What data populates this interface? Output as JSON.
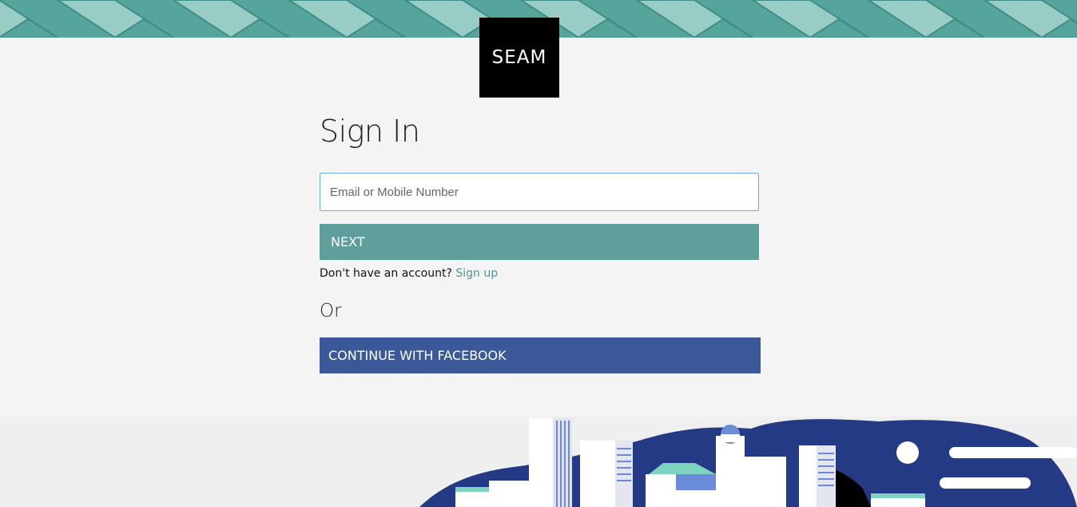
{
  "brand": {
    "logo_text": "SEAM"
  },
  "signin": {
    "title": "Sign In",
    "email_placeholder": "Email or Mobile Number",
    "next_label": "NEXT",
    "no_account_text": "Don't have an account?",
    "signup_link": "Sign up",
    "or_text": "Or",
    "facebook_label": "CONTINUE WITH FACEBOOK"
  },
  "colors": {
    "banner_teal": "#55a59d",
    "next_button": "#5e9f9c",
    "facebook_button": "#3b5898",
    "input_border": "#6bb3dc"
  }
}
